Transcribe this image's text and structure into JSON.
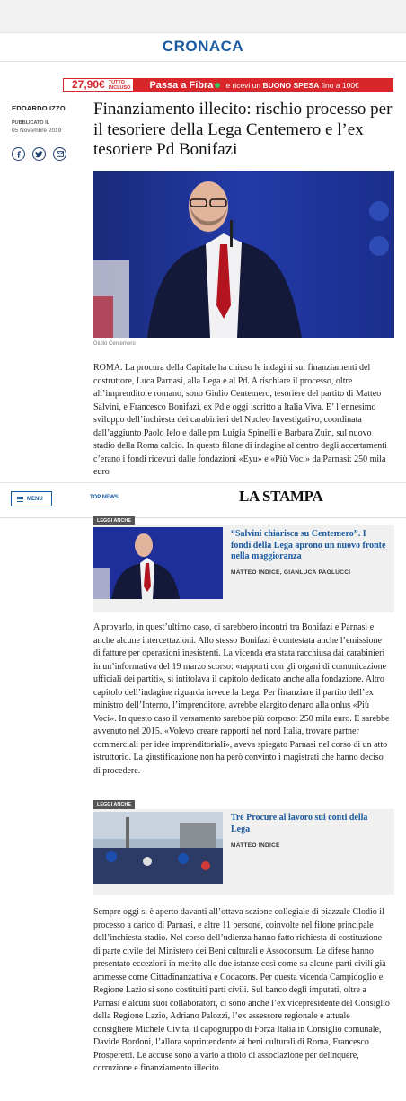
{
  "section": {
    "title": "CRONACA"
  },
  "ad": {
    "price": "27,90€",
    "price_tag_line1": "TUTTO",
    "price_tag_line2": "INCLUSO",
    "main": "Passa a Fibra",
    "rest_prefix": "e ricevi un",
    "rest_bold": "BUONO SPESA",
    "rest_suffix": "fino a 100€"
  },
  "article": {
    "author": "EDOARDO IZZO",
    "published_label": "PUBBLICATO IL",
    "published_date": "05 Novembre 2019",
    "headline": "Finanziamento illecito: rischio processo per il tesoriere della Lega Centemero e l’ex tesoriere Pd Bonifazi",
    "photo_caption": "Giulio Centemero",
    "paragraphs": [
      "ROMA. La procura della Capitale ha chiuso le indagini sui finanziamenti del costruttore, Luca Parnasi, alla Lega e al Pd. A rischiare il processo, oltre all’imprenditore romano, sono Giulio Centemero, tesoriere del partito di Matteo Salvini, e Francesco Bonifazi, ex Pd e oggi iscritto a Italia Viva. E’ l’ennesimo sviluppo dell’inchiesta dei carabinieri del Nucleo Investigativo, coordinata dall’aggiunto Paolo Ielo e dalle pm Luigia Spinelli e Barbara Zuin, sul nuovo stadio della Roma calcio. In questo filone di indagine al centro degli accertamenti c’erano i fondi ricevuti dalle fondazioni «Eyu» e «Più Voci» da Parnasi: 250 mila euro",
      "A provarlo, in quest’ultimo caso, ci sarebbero incontri tra Bonifazi e Parnasi e anche alcune intercettazioni. Allo stesso Bonifazi è contestata anche l’emissione di fatture per operazioni inesistenti. La vicenda era stata racchiusa dai carabinieri in un’informativa del 19 marzo scorso: «rapporti con gli organi di comunicazione ufficiali dei partiti», si intitolava il capitolo dedicato anche alla fondazione. Altro capitolo dell’indagine riguarda invece la Lega. Per finanziare il partito dell’ex ministro dell’Interno, l’imprenditore, avrebbe elargito denaro alla onlus «Più Voci». In questo caso il versamento sarebbe più corposo: 250 mila euro. E sarebbe avvenuto nel 2015. «Volevo creare rapporti nel nord Italia, trovare partner commerciali per idee imprenditoriali», aveva spiegato Parnasi nel corso di un atto istruttorio. La giustificazione non ha però convinto i magistrati che hanno deciso di procedere.",
      "Sempre oggi si è aperto davanti all’ottava sezione collegiale di piazzale Clodio il processo a carico di Parnasi, e altre 11 persone, coinvolte nel filone principale dell’inchiesta stadio. Nel corso dell’udienza hanno fatto richiesta di costituzione di parte civile del Ministero dei Beni culturali e Assoconsum. Le difese hanno presentato eccezioni in merito alle due istanze così come su alcune parti civili già ammesse come Cittadinanzattiva e Codacons. Per questa vicenda Campidoglio e Regione Lazio si sono costituiti parti civili. Sul banco degli imputati, oltre a Parnasi e alcuni suoi collaboratori, ci sono anche l’ex vicepresidente del Consiglio della Regione Lazio, Adriano Palozzi, l’ex assessore regionale e attuale consigliere Michele Civita, il capogruppo di Forza Italia in Consiglio comunale, Davide Bordoni, l’allora soprintendente ai beni culturali di Roma, Francesco Prosperetti. Le accuse sono a vario a titolo di associazione per delinquere, corruzione e finanziamento illecito."
    ]
  },
  "navbar": {
    "menu_label": "MENU",
    "topnews_label": "TOP NEWS",
    "logo": "LA STAMPA"
  },
  "related": [
    {
      "tag": "LEGGI ANCHE",
      "title": "“Salvini chiarisca su Centemero”. I fondi della Lega aprono un nuovo fronte nella maggioranza",
      "authors": "MATTEO INDICE, GIANLUCA PAOLUCCI"
    },
    {
      "tag": "LEGGI ANCHE",
      "title": "Tre Procure al lavoro sui conti della Lega",
      "authors": "MATTEO INDICE"
    }
  ],
  "colors": {
    "brand_blue": "#1a5aa0",
    "ad_red": "#d8262a",
    "related_bg": "#f0f0f0"
  }
}
